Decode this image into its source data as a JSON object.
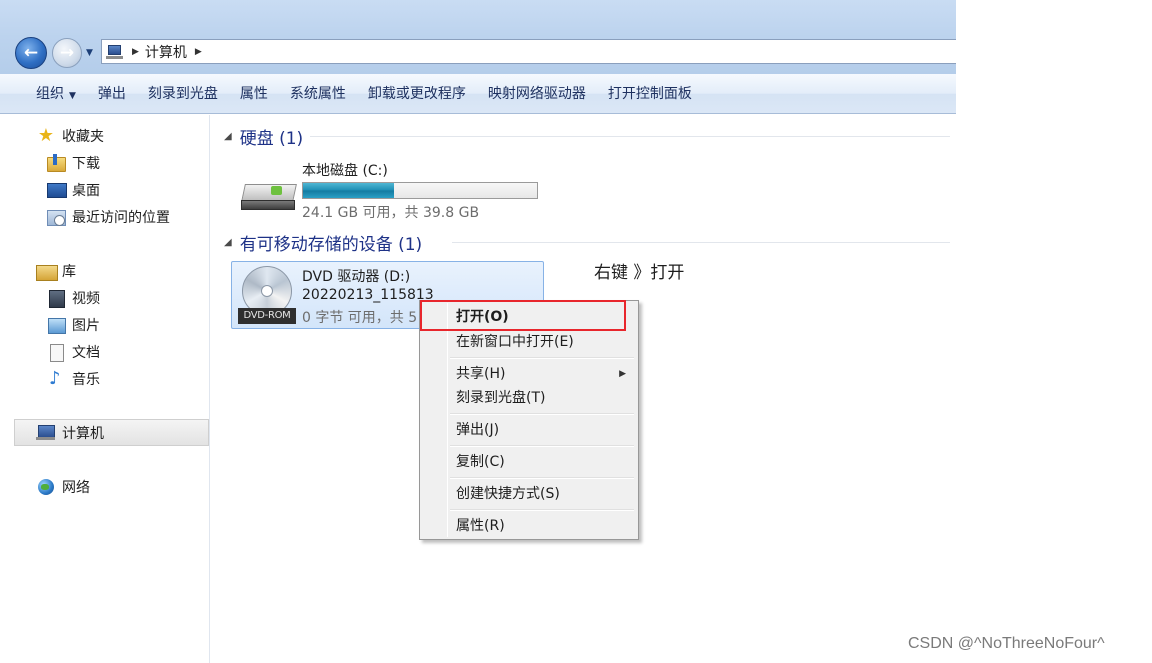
{
  "address_bar": {
    "path": "计算机"
  },
  "toolbar": {
    "items": [
      "组织",
      "弹出",
      "刻录到光盘",
      "属性",
      "系统属性",
      "卸载或更改程序",
      "映射网络驱动器",
      "打开控制面板"
    ]
  },
  "sidebar": {
    "favorites": {
      "label": "收藏夹",
      "items": [
        "下载",
        "桌面",
        "最近访问的位置"
      ]
    },
    "libraries": {
      "label": "库",
      "items": [
        "视频",
        "图片",
        "文档",
        "音乐"
      ]
    },
    "computer": {
      "label": "计算机"
    },
    "network": {
      "label": "网络"
    }
  },
  "hard_disks": {
    "heading": "硬盘 (1)",
    "drives": [
      {
        "name": "本地磁盘 (C:)",
        "usage_fraction": 0.39,
        "space_text": "24.1 GB 可用，共 39.8 GB"
      }
    ]
  },
  "removable": {
    "heading": "有可移动存储的设备 (1)",
    "drives": [
      {
        "name": "DVD 驱动器 (D:)",
        "volume_label": "20220213_115813",
        "space_text": "0 字节 可用，共 5",
        "badge": "DVD-ROM"
      }
    ]
  },
  "context_menu": {
    "items": [
      {
        "label": "打开(O)",
        "bold": true
      },
      {
        "label": "在新窗口中打开(E)"
      },
      {
        "label": "共享(H)",
        "submenu": true
      },
      {
        "label": "刻录到光盘(T)"
      },
      {
        "label": "弹出(J)"
      },
      {
        "label": "复制(C)"
      },
      {
        "label": "创建快捷方式(S)"
      },
      {
        "label": "属性(R)"
      }
    ]
  },
  "annotation": {
    "text": "右键 》打开"
  },
  "watermark": {
    "text": "CSDN @^NoThreeNoFour^"
  },
  "colors": {
    "highlight_box": "#e8262c",
    "section_heading": "#1e3287",
    "capacity_bar": "#1c8db3"
  },
  "icons": {
    "nav_back": "back-arrow-icon",
    "nav_forward": "forward-arrow-icon",
    "favorites": "star-icon",
    "downloads": "downloads-folder-icon",
    "desktop": "desktop-icon",
    "recent": "recent-places-icon",
    "libraries": "library-icon",
    "videos": "video-library-icon",
    "pictures": "picture-library-icon",
    "documents": "document-library-icon",
    "music": "music-library-icon",
    "computer": "computer-icon",
    "network": "network-icon",
    "hard_disk": "hard-disk-icon",
    "dvd": "dvd-drive-icon"
  }
}
